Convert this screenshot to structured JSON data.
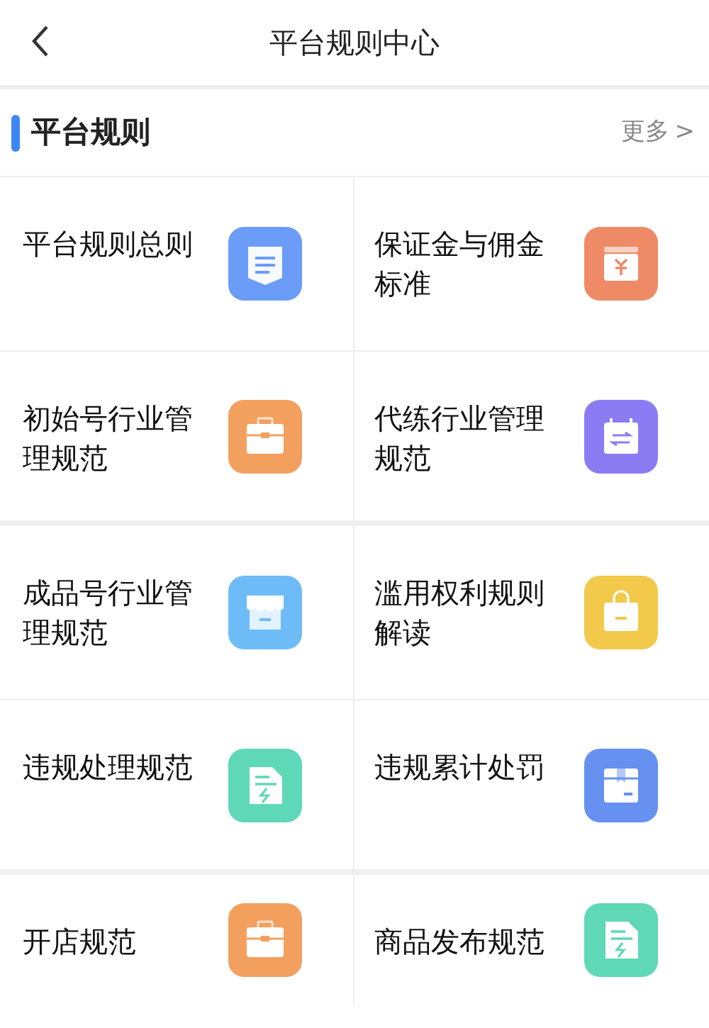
{
  "header": {
    "title": "平台规则中心"
  },
  "section": {
    "title": "平台规则",
    "more": "更多",
    "more_arrow": ">"
  },
  "items": [
    {
      "label": "平台规则总则",
      "kind": "doc",
      "color": "#6b9cf7"
    },
    {
      "label": "保证金与佣金标准",
      "kind": "money",
      "color": "#ef8a66"
    },
    {
      "label": "初始号行业管理规范",
      "kind": "briefcase",
      "color": "#f3a05f"
    },
    {
      "label": "代练行业管理规范",
      "kind": "calendar",
      "color": "#8c7cf4"
    },
    {
      "label": "成品号行业管理规范",
      "kind": "shop",
      "color": "#6ebcf7"
    },
    {
      "label": "滥用权利规则解读",
      "kind": "bag",
      "color": "#f2c94a"
    },
    {
      "label": "违规处理规范",
      "kind": "file",
      "color": "#5fd8b8"
    },
    {
      "label": "违规累计处罚",
      "kind": "box",
      "color": "#6691f0"
    },
    {
      "label": "开店规范",
      "kind": "briefcase",
      "color": "#f3a05f"
    },
    {
      "label": "商品发布规范",
      "kind": "file",
      "color": "#5fd8b8"
    }
  ]
}
